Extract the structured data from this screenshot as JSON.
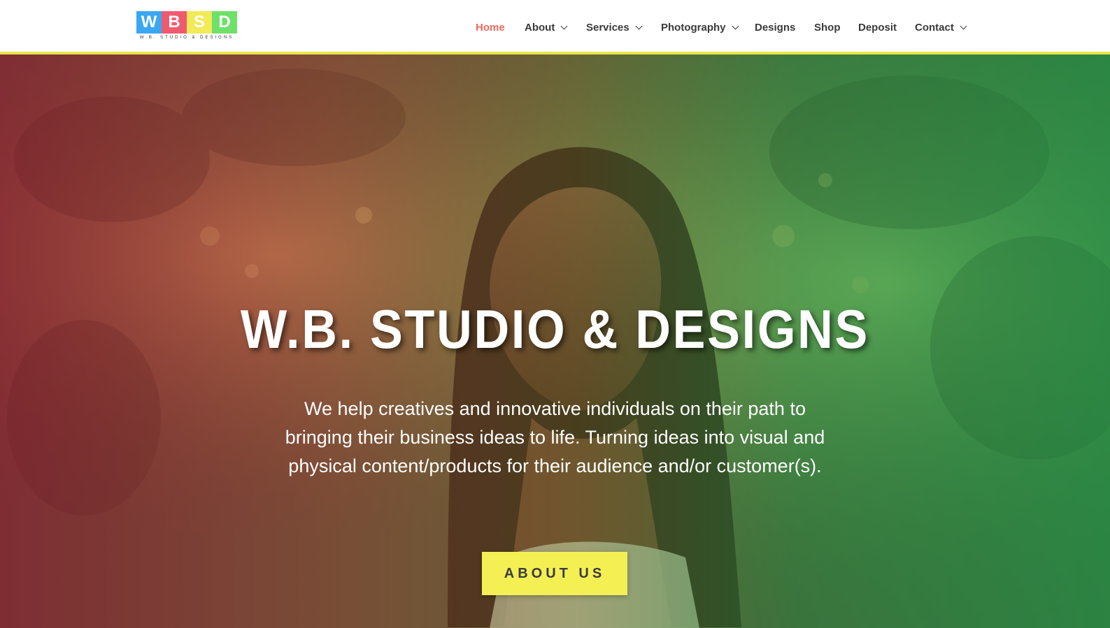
{
  "header": {
    "logo": {
      "letters": [
        "W",
        "B",
        "S",
        "D"
      ],
      "letter_colors": [
        "#3aa7f2",
        "#ef5a6f",
        "#f2ea56",
        "#6fe06a"
      ],
      "tagline": "W.B. STUDIO & DESIGNS"
    },
    "nav": [
      {
        "label": "Home",
        "active": true,
        "dropdown": false
      },
      {
        "label": "About",
        "active": false,
        "dropdown": true
      },
      {
        "label": "Services",
        "active": false,
        "dropdown": true
      },
      {
        "label": "Photography",
        "active": false,
        "dropdown": true
      },
      {
        "label": "Designs",
        "active": false,
        "dropdown": false
      },
      {
        "label": "Shop",
        "active": false,
        "dropdown": false
      },
      {
        "label": "Deposit",
        "active": false,
        "dropdown": false
      },
      {
        "label": "Contact",
        "active": false,
        "dropdown": true
      }
    ]
  },
  "hero": {
    "title": "W.B. STUDIO & DESIGNS",
    "description": "We help creatives and innovative individuals on their path to bringing their business ideas to life. Turning ideas into visual and physical content/products for their audience and/or customer(s).",
    "button_label": "ABOUT US"
  },
  "colors": {
    "accent_active": "#ef6b5e",
    "header_rule": "#e8e54a",
    "button_bg": "#f4f054"
  }
}
